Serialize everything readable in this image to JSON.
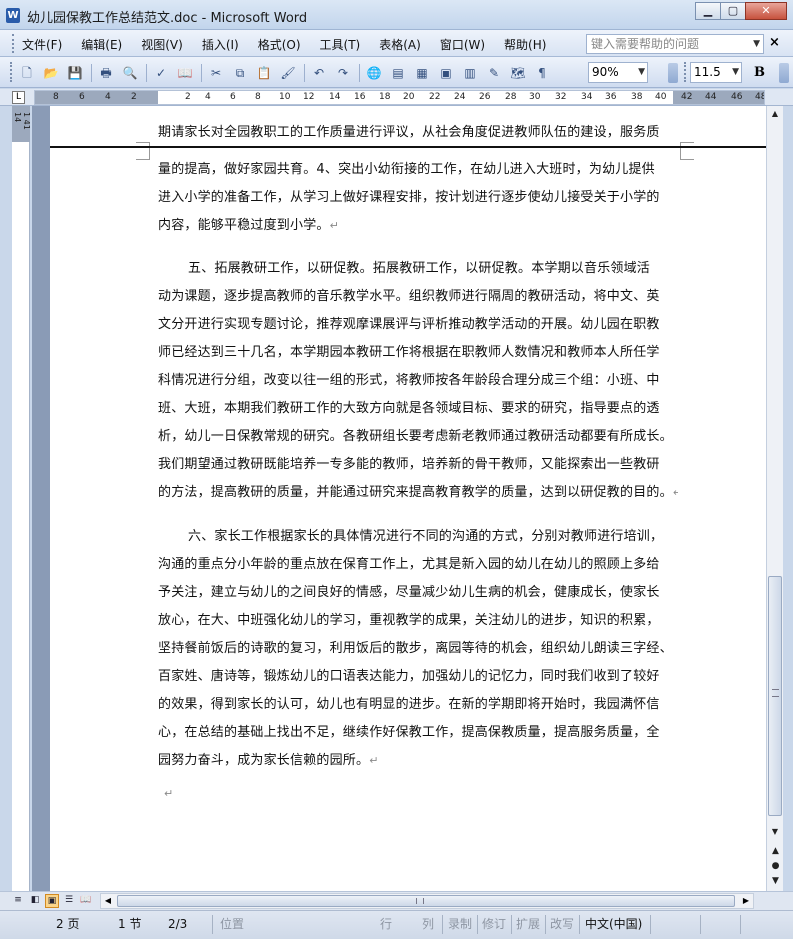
{
  "window": {
    "title": "幼儿园保教工作总结范文.doc - Microsoft Word",
    "app_icon": "W"
  },
  "menu": {
    "items": [
      "文件(F)",
      "编辑(E)",
      "视图(V)",
      "插入(I)",
      "格式(O)",
      "工具(T)",
      "表格(A)",
      "窗口(W)",
      "帮助(H)"
    ],
    "help_placeholder": "键入需要帮助的问题"
  },
  "toolbar": {
    "zoom": "90%",
    "font_size": "11.5",
    "bold_label": "B"
  },
  "ruler": {
    "numbers": [
      "8",
      "6",
      "4",
      "2",
      "2",
      "4",
      "6",
      "8",
      "10",
      "12",
      "14",
      "16",
      "18",
      "20",
      "22",
      "24",
      "26",
      "28",
      "30",
      "32",
      "34",
      "36",
      "38",
      "40",
      "42",
      "44",
      "46",
      "48"
    ],
    "vertical_label": "1 41 14"
  },
  "document": {
    "colors": {
      "page_break_line": "#111111",
      "pilcrow": "#8a8a8a"
    },
    "p1_lines": [
      "期请家长对全园教职工的工作质量进行评议，从社会角度促进教师队伍的建设，服务质"
    ],
    "p2_lines": [
      "量的提高，做好家园共育。4、突出小幼衔接的工作，在幼儿进入大班时，为幼儿提供",
      "进入小学的准备工作，从学习上做好课程安排，按计划进行逐步使幼儿接受关于小学的",
      "内容，能够平稳过度到小学。"
    ],
    "p3_lines": [
      "五、拓展教研工作，以研促教。拓展教研工作，以研促教。本学期以音乐领域活",
      "动为课题，逐步提高教师的音乐教学水平。组织教师进行隔周的教研活动，将中文、英",
      "文分开进行实现专题讨论，推荐观摩课展评与评析推动教学活动的开展。幼儿园在职教",
      "师已经达到三十几名，本学期园本教研工作将根据在职教师人数情况和教师本人所任学",
      "科情况进行分组，改变以往一组的形式，将教师按各年龄段合理分成三个组：小班、中",
      "班、大班，本期我们教研工作的大致方向就是各领域目标、要求的研究，指导要点的透",
      "析，幼儿一日保教常规的研究。各教研组长要考虑新老教师通过教研活动都要有所成长。",
      "我们期望通过教研既能培养一专多能的教师，培养新的骨干教师，又能探索出一些教研",
      "的方法，提高教研的质量，并能通过研究来提高教育教学的质量，达到以研促教的目的。"
    ],
    "p4_lines": [
      "六、家长工作根据家长的具体情况进行不同的沟通的方式，分别对教师进行培训，",
      "沟通的重点分小年龄的重点放在保育工作上，尤其是新入园的幼儿在幼儿的照顾上多给",
      "予关注，建立与幼儿的之间良好的情感，尽量减少幼儿生病的机会，健康成长，使家长",
      "放心，在大、中班强化幼儿的学习，重视教学的成果，关注幼儿的进步，知识的积累，",
      "坚持餐前饭后的诗歌的复习，利用饭后的散步，离园等待的机会，组织幼儿朗读三字经、",
      "百家姓、唐诗等，锻炼幼儿的口语表达能力，加强幼儿的记忆力，同时我们收到了较好",
      "的效果，得到家长的认可，幼儿也有明显的进步。在新的学期即将开始时，我园满怀信",
      "心，在总结的基础上找出不足，继续作好保教工作，提高保教质量，提高服务质量，全",
      "园努力奋斗，成为家长信赖的园所。"
    ],
    "pilcrow": "↵"
  },
  "statusbar": {
    "page": "2 页",
    "section": "1 节",
    "page_of": "2/3",
    "position": "位置",
    "line": "行",
    "column": "列",
    "rec": "录制",
    "trk": "修订",
    "ext": "扩展",
    "ovr": "改写",
    "language": "中文(中国)"
  }
}
